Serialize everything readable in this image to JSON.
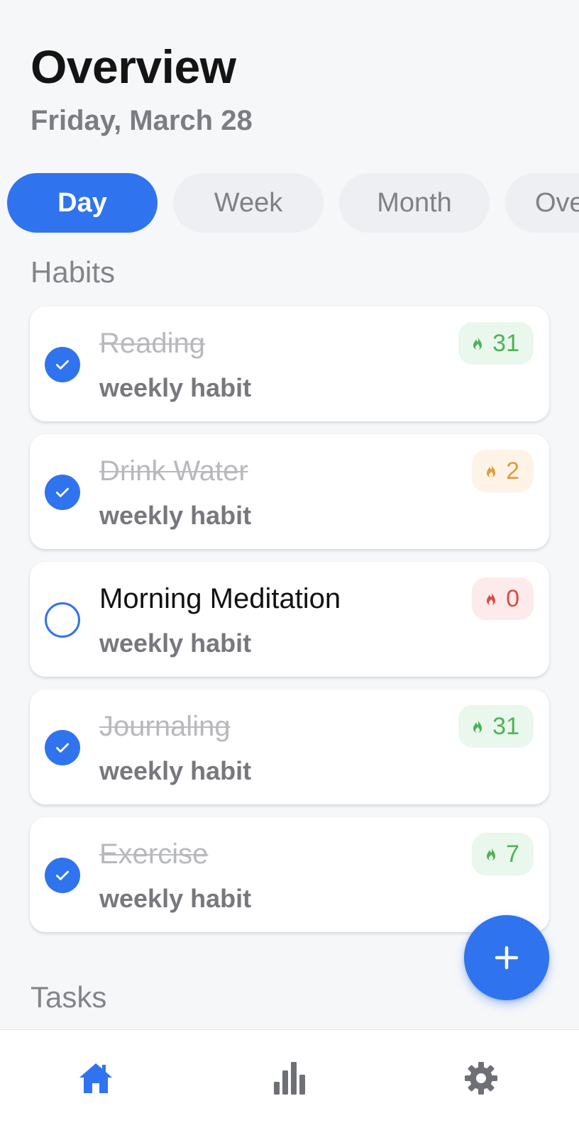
{
  "header": {
    "title": "Overview",
    "date": "Friday, March 28"
  },
  "tabs": [
    {
      "label": "Day",
      "active": true
    },
    {
      "label": "Week",
      "active": false
    },
    {
      "label": "Month",
      "active": false
    },
    {
      "label": "Ove",
      "active": false
    }
  ],
  "sections": {
    "habits": "Habits",
    "tasks": "Tasks"
  },
  "habits": [
    {
      "name": "Reading",
      "subtitle": "weekly habit",
      "completed": true,
      "streak": "31",
      "streak_color": "green"
    },
    {
      "name": "Drink Water",
      "subtitle": "weekly habit",
      "completed": true,
      "streak": "2",
      "streak_color": "orange"
    },
    {
      "name": "Morning Meditation",
      "subtitle": "weekly habit",
      "completed": false,
      "streak": "0",
      "streak_color": "red"
    },
    {
      "name": "Journaling",
      "subtitle": "weekly habit",
      "completed": true,
      "streak": "31",
      "streak_color": "green"
    },
    {
      "name": "Exercise",
      "subtitle": "weekly habit",
      "completed": true,
      "streak": "7",
      "streak_color": "green"
    }
  ],
  "fab": {
    "icon": "plus-icon"
  },
  "bottom_nav": [
    {
      "icon": "home-icon",
      "active": true
    },
    {
      "icon": "bar-chart-icon",
      "active": false
    },
    {
      "icon": "gear-icon",
      "active": false
    }
  ],
  "colors": {
    "accent": "#2f74ee",
    "background": "#f6f7f9",
    "streak_green": "#4db35a",
    "streak_orange": "#e49a35",
    "streak_red": "#dd4b41",
    "inactive_icon": "#6f7075"
  }
}
